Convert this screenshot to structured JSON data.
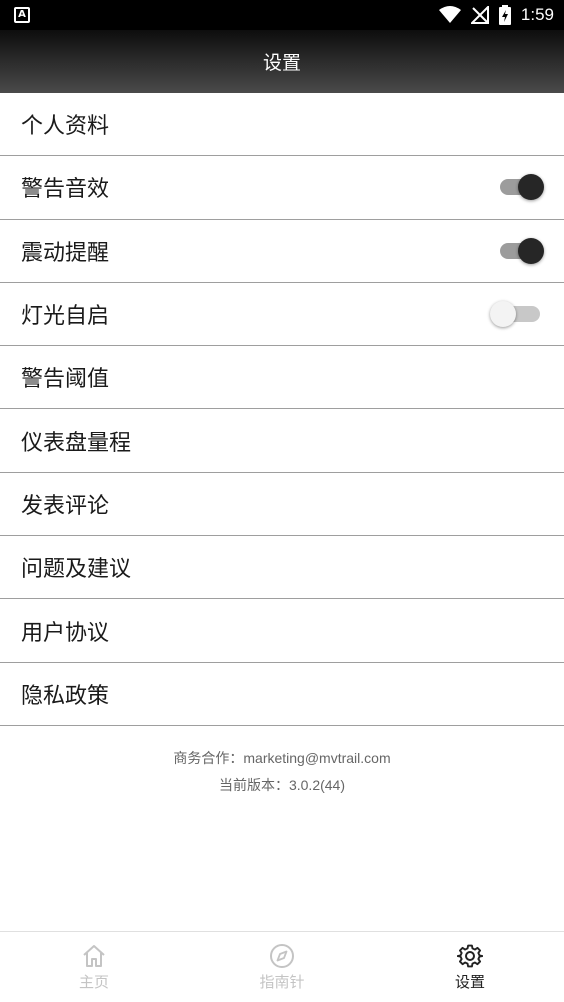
{
  "status_bar": {
    "app_icon": "A",
    "time": "1:59",
    "icons": [
      "wifi-icon",
      "signal-off-icon",
      "battery-charging-icon"
    ]
  },
  "header": {
    "title": "设置"
  },
  "settings": [
    {
      "label": "个人资料"
    },
    {
      "label": "警告音效",
      "toggle": true
    },
    {
      "label": "震动提醒",
      "toggle": true
    },
    {
      "label": "灯光自启",
      "toggle": false
    },
    {
      "label": "警告阈值"
    },
    {
      "label": "仪表盘量程"
    },
    {
      "label": "发表评论"
    },
    {
      "label": "问题及建议"
    },
    {
      "label": "用户协议"
    },
    {
      "label": "隐私政策"
    }
  ],
  "footer": {
    "business": "商务合作：marketing@mvtrail.com",
    "version": "当前版本：3.0.2(44)"
  },
  "bottom_nav": [
    {
      "label": "主页",
      "icon": "home-icon",
      "active": false
    },
    {
      "label": "指南针",
      "icon": "compass-icon",
      "active": false
    },
    {
      "label": "设置",
      "icon": "gear-icon",
      "active": true
    }
  ]
}
